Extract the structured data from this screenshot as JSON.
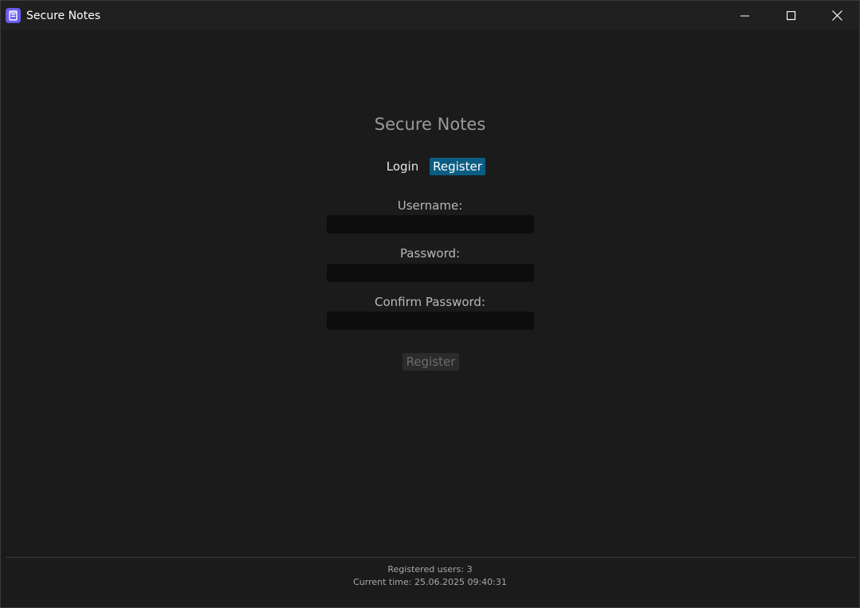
{
  "window": {
    "title": "Secure Notes",
    "icon": "notes-app-icon",
    "accent": "#6b5bf0"
  },
  "main": {
    "title": "Secure Notes",
    "tabs": [
      {
        "label": "Login",
        "active": false
      },
      {
        "label": "Register",
        "active": true
      }
    ],
    "active_tab_color": "#0c5d83",
    "fields": {
      "username_label": "Username:",
      "username_value": "",
      "password_label": "Password:",
      "password_value": "",
      "confirm_label": "Confirm Password:",
      "confirm_value": ""
    },
    "submit_label": "Register"
  },
  "footer": {
    "users": "Registered users: 3",
    "time": "Current time: 25.06.2025 09:40:31"
  }
}
